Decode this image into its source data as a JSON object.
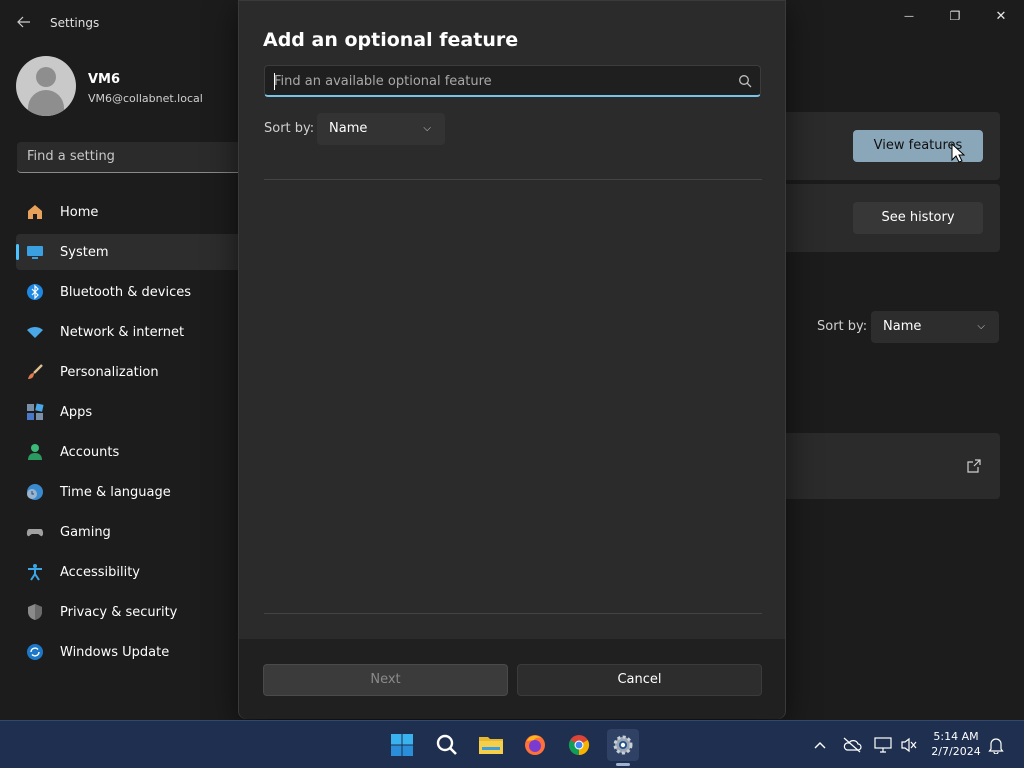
{
  "window": {
    "title": "Settings",
    "back_icon": "arrow-left-icon",
    "minimize_glyph": "—",
    "restore_glyph": "❐",
    "close_glyph": "✕"
  },
  "profile": {
    "name": "VM6",
    "email": "VM6@collabnet.local"
  },
  "sidebar": {
    "search_placeholder": "Find a setting",
    "items": [
      {
        "label": "Home",
        "icon": "home-icon",
        "active": false
      },
      {
        "label": "System",
        "icon": "system-icon",
        "active": true
      },
      {
        "label": "Bluetooth & devices",
        "icon": "bluetooth-icon",
        "active": false
      },
      {
        "label": "Network & internet",
        "icon": "wifi-icon",
        "active": false
      },
      {
        "label": "Personalization",
        "icon": "brush-icon",
        "active": false
      },
      {
        "label": "Apps",
        "icon": "apps-icon",
        "active": false
      },
      {
        "label": "Accounts",
        "icon": "accounts-icon",
        "active": false
      },
      {
        "label": "Time & language",
        "icon": "clock-globe-icon",
        "active": false
      },
      {
        "label": "Gaming",
        "icon": "gamepad-icon",
        "active": false
      },
      {
        "label": "Accessibility",
        "icon": "accessibility-icon",
        "active": false
      },
      {
        "label": "Privacy & security",
        "icon": "shield-icon",
        "active": false
      },
      {
        "label": "Windows Update",
        "icon": "update-icon",
        "active": false
      }
    ]
  },
  "content": {
    "view_features_label": "View features",
    "see_history_label": "See history",
    "sort_label": "Sort by:",
    "sort_value": "Name"
  },
  "dialog": {
    "title": "Add an optional feature",
    "search_placeholder": "Find an available optional feature",
    "search_value": "",
    "sort_label": "Sort by:",
    "sort_value": "Name",
    "next_label": "Next",
    "cancel_label": "Cancel"
  },
  "taskbar": {
    "apps": [
      "start-icon",
      "search-icon",
      "file-explorer-icon",
      "firefox-icon",
      "chrome-icon",
      "settings-icon"
    ],
    "tray": [
      "chevron-up-icon",
      "onedrive-offline-icon",
      "network-icon",
      "volume-muted-icon",
      "notifications-icon"
    ],
    "time": "5:14 AM",
    "date": "2/7/2024"
  },
  "colors": {
    "accent": "#4cc2ff",
    "primary_button": "#8aa7ba",
    "taskbar": "#1f2f4f"
  }
}
